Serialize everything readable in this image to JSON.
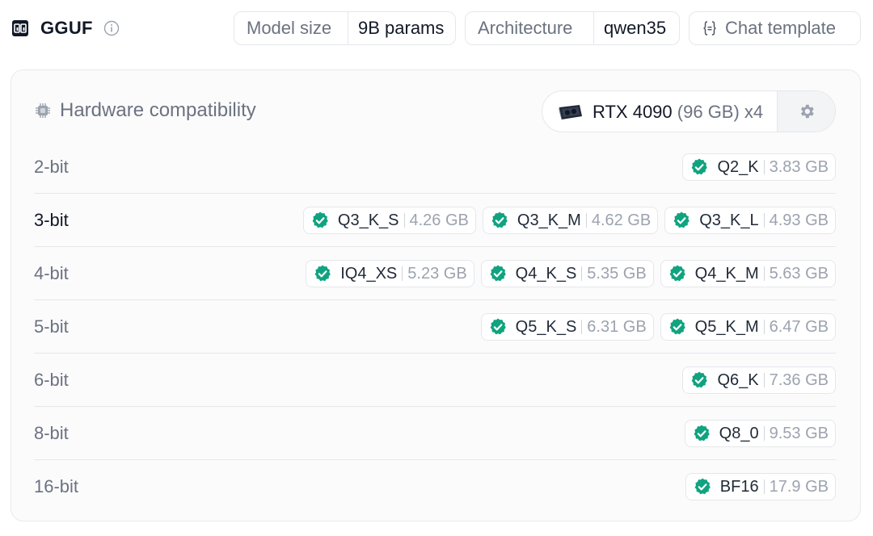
{
  "header": {
    "title": "GGUF",
    "logo_icon": "gguf-logo-icon",
    "info_icon": "info-icon",
    "model_size": {
      "label": "Model size",
      "value": "9B params"
    },
    "architecture": {
      "label": "Architecture",
      "value": "qwen35"
    },
    "chat_template": {
      "label": "Chat template",
      "icon": "braces-icon"
    }
  },
  "hardware": {
    "title": "Hardware compatibility",
    "gpu_name": "RTX 4090",
    "gpu_memory": "(96 GB) x4",
    "settings_icon": "gear-icon"
  },
  "colors": {
    "accent_green": "#10a37f",
    "muted": "#6b7280",
    "border": "#e5e7eb"
  },
  "rows": [
    {
      "bits": "2-bit",
      "quants": [
        {
          "name": "Q2_K",
          "size": "3.83 GB"
        }
      ]
    },
    {
      "bits": "3-bit",
      "quants": [
        {
          "name": "Q3_K_S",
          "size": "4.26 GB"
        },
        {
          "name": "Q3_K_M",
          "size": "4.62 GB"
        },
        {
          "name": "Q3_K_L",
          "size": "4.93 GB"
        }
      ]
    },
    {
      "bits": "4-bit",
      "quants": [
        {
          "name": "IQ4_XS",
          "size": "5.23 GB"
        },
        {
          "name": "Q4_K_S",
          "size": "5.35 GB"
        },
        {
          "name": "Q4_K_M",
          "size": "5.63 GB"
        }
      ]
    },
    {
      "bits": "5-bit",
      "quants": [
        {
          "name": "Q5_K_S",
          "size": "6.31 GB"
        },
        {
          "name": "Q5_K_M",
          "size": "6.47 GB"
        }
      ]
    },
    {
      "bits": "6-bit",
      "quants": [
        {
          "name": "Q6_K",
          "size": "7.36 GB"
        }
      ]
    },
    {
      "bits": "8-bit",
      "quants": [
        {
          "name": "Q8_0",
          "size": "9.53 GB"
        }
      ]
    },
    {
      "bits": "16-bit",
      "quants": [
        {
          "name": "BF16",
          "size": "17.9 GB"
        }
      ]
    }
  ]
}
